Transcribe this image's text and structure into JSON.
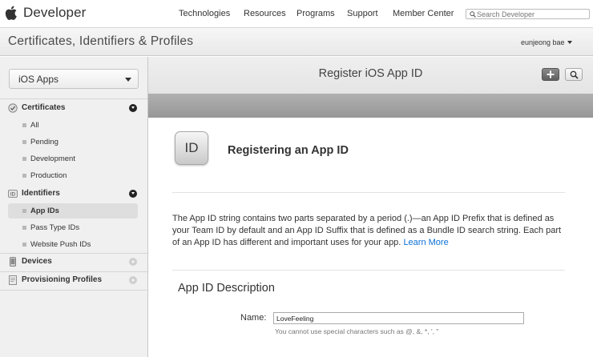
{
  "header": {
    "brand": "Developer",
    "nav": [
      "Technologies",
      "Resources",
      "Programs",
      "Support",
      "Member Center"
    ],
    "search_placeholder": "Search Developer"
  },
  "section": {
    "title": "Certificates, Identifiers & Profiles",
    "user": "eunjeong bae"
  },
  "sidebar": {
    "platform": "iOS Apps",
    "groups": [
      {
        "label": "Certificates",
        "icon": "certificate-icon",
        "expanded": true,
        "items": [
          "All",
          "Pending",
          "Development",
          "Production"
        ]
      },
      {
        "label": "Identifiers",
        "icon": "id-badge-icon",
        "expanded": true,
        "items": [
          "App IDs",
          "Pass Type IDs",
          "Website Push IDs"
        ],
        "active_item": "App IDs"
      },
      {
        "label": "Devices",
        "icon": "device-icon",
        "expanded": false,
        "items": []
      },
      {
        "label": "Provisioning Profiles",
        "icon": "profile-icon",
        "expanded": false,
        "items": []
      }
    ]
  },
  "main": {
    "title": "Register iOS App ID",
    "icon_text": "ID",
    "heading": "Registering an App ID",
    "description": "The App ID string contains two parts separated by a period (.)—an App ID Prefix that is defined as your Team ID by default and an App ID Suffix that is defined as a Bundle ID search string. Each part of an App ID has different and important uses for your app.",
    "learn_more": "Learn More",
    "form_title": "App ID Description",
    "name_label": "Name:",
    "name_value": "LoveFeeling",
    "name_help": "You cannot use special characters such as @, &, *, ', \""
  },
  "colors": {
    "link": "#0a6fd6",
    "sidebar_bg": "#f0f0f0",
    "toolbar_bar": "#a3a3a3"
  }
}
